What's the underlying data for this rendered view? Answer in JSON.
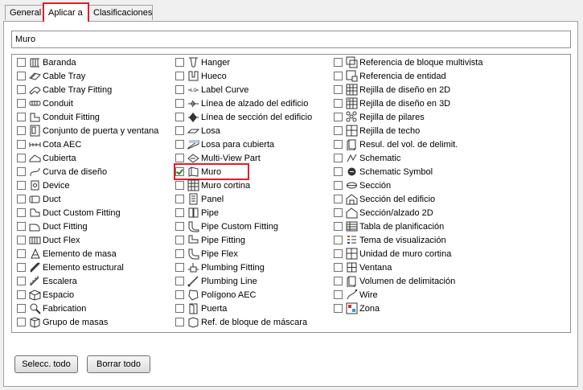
{
  "tabs": [
    {
      "label": "General"
    },
    {
      "label": "Aplicar a",
      "active": true
    },
    {
      "label": "Clasificaciones"
    }
  ],
  "name_field": {
    "value": "Muro"
  },
  "columns": [
    [
      {
        "label": "Baranda",
        "icon": "railing-icon"
      },
      {
        "label": "Cable Tray",
        "icon": "cable-tray-icon"
      },
      {
        "label": "Cable Tray Fitting",
        "icon": "cable-tray-fitting-icon"
      },
      {
        "label": "Conduit",
        "icon": "conduit-icon"
      },
      {
        "label": "Conduit Fitting",
        "icon": "conduit-fitting-icon"
      },
      {
        "label": "Conjunto de puerta y ventana",
        "icon": "door-window-assembly-icon"
      },
      {
        "label": "Cota AEC",
        "icon": "aec-dimension-icon"
      },
      {
        "label": "Cubierta",
        "icon": "roof-icon"
      },
      {
        "label": "Curva de diseño",
        "icon": "layout-curve-icon"
      },
      {
        "label": "Device",
        "icon": "device-icon"
      },
      {
        "label": "Duct",
        "icon": "duct-icon"
      },
      {
        "label": "Duct Custom Fitting",
        "icon": "duct-custom-fitting-icon"
      },
      {
        "label": "Duct Fitting",
        "icon": "duct-fitting-icon"
      },
      {
        "label": "Duct Flex",
        "icon": "duct-flex-icon"
      },
      {
        "label": "Elemento de masa",
        "icon": "mass-element-icon"
      },
      {
        "label": "Elemento estructural",
        "icon": "structural-member-icon"
      },
      {
        "label": "Escalera",
        "icon": "stair-icon"
      },
      {
        "label": "Espacio",
        "icon": "space-icon"
      },
      {
        "label": "Fabrication",
        "icon": "fabrication-icon"
      },
      {
        "label": "Grupo de masas",
        "icon": "mass-group-icon"
      }
    ],
    [
      {
        "label": "Hanger",
        "icon": "hanger-icon"
      },
      {
        "label": "Hueco",
        "icon": "opening-icon"
      },
      {
        "label": "Label Curve",
        "icon": "label-curve-icon"
      },
      {
        "label": "Línea de alzado del edificio",
        "icon": "elevation-line-icon"
      },
      {
        "label": "Línea de sección del edificio",
        "icon": "section-line-icon"
      },
      {
        "label": "Losa",
        "icon": "slab-icon"
      },
      {
        "label": "Losa para cubierta",
        "icon": "roof-slab-icon"
      },
      {
        "label": "Multi-View Part",
        "icon": "multi-view-part-icon"
      },
      {
        "label": "Muro",
        "icon": "wall-icon",
        "checked": true,
        "highlighted": true
      },
      {
        "label": "Muro cortina",
        "icon": "curtain-wall-icon"
      },
      {
        "label": "Panel",
        "icon": "panel-icon"
      },
      {
        "label": "Pipe",
        "icon": "pipe-icon"
      },
      {
        "label": "Pipe Custom Fitting",
        "icon": "pipe-custom-fitting-icon"
      },
      {
        "label": "Pipe Fitting",
        "icon": "pipe-fitting-icon"
      },
      {
        "label": "Pipe Flex",
        "icon": "pipe-flex-icon"
      },
      {
        "label": "Plumbing Fitting",
        "icon": "plumbing-fitting-icon"
      },
      {
        "label": "Plumbing Line",
        "icon": "plumbing-line-icon"
      },
      {
        "label": "Polígono AEC",
        "icon": "aec-polygon-icon"
      },
      {
        "label": "Puerta",
        "icon": "door-icon"
      },
      {
        "label": "Ref. de bloque de máscara",
        "icon": "mask-block-ref-icon"
      }
    ],
    [
      {
        "label": "Referencia de bloque multivista",
        "icon": "multi-view-block-ref-icon"
      },
      {
        "label": "Referencia de entidad",
        "icon": "entity-reference-icon"
      },
      {
        "label": "Rejilla de diseño en 2D",
        "icon": "grid-2d-icon"
      },
      {
        "label": "Rejilla de diseño en 3D",
        "icon": "grid-3d-icon"
      },
      {
        "label": "Rejilla de pilares",
        "icon": "column-grid-icon"
      },
      {
        "label": "Rejilla de techo",
        "icon": "ceiling-grid-icon"
      },
      {
        "label": "Resul. del vol. de delimit.",
        "icon": "bounding-volume-result-icon"
      },
      {
        "label": "Schematic",
        "icon": "schematic-icon"
      },
      {
        "label": "Schematic Symbol",
        "icon": "schematic-symbol-icon"
      },
      {
        "label": "Sección",
        "icon": "section-icon"
      },
      {
        "label": "Sección del edificio",
        "icon": "building-section-icon"
      },
      {
        "label": "Sección/alzado 2D",
        "icon": "section-elevation-2d-icon"
      },
      {
        "label": "Tabla de planificación",
        "icon": "schedule-table-icon"
      },
      {
        "label": "Tema de visualización",
        "icon": "display-theme-icon"
      },
      {
        "label": "Unidad de muro cortina",
        "icon": "curtain-wall-unit-icon"
      },
      {
        "label": "Ventana",
        "icon": "window-icon"
      },
      {
        "label": "Volumen de delimitación",
        "icon": "bounding-volume-icon"
      },
      {
        "label": "Wire",
        "icon": "wire-icon"
      },
      {
        "label": "Zona",
        "icon": "zone-icon"
      }
    ]
  ],
  "buttons": {
    "select_all": "Selecc. todo",
    "clear_all": "Borrar todo"
  },
  "colors": {
    "highlight": "#e51c23",
    "check": "#1a8a1a"
  }
}
